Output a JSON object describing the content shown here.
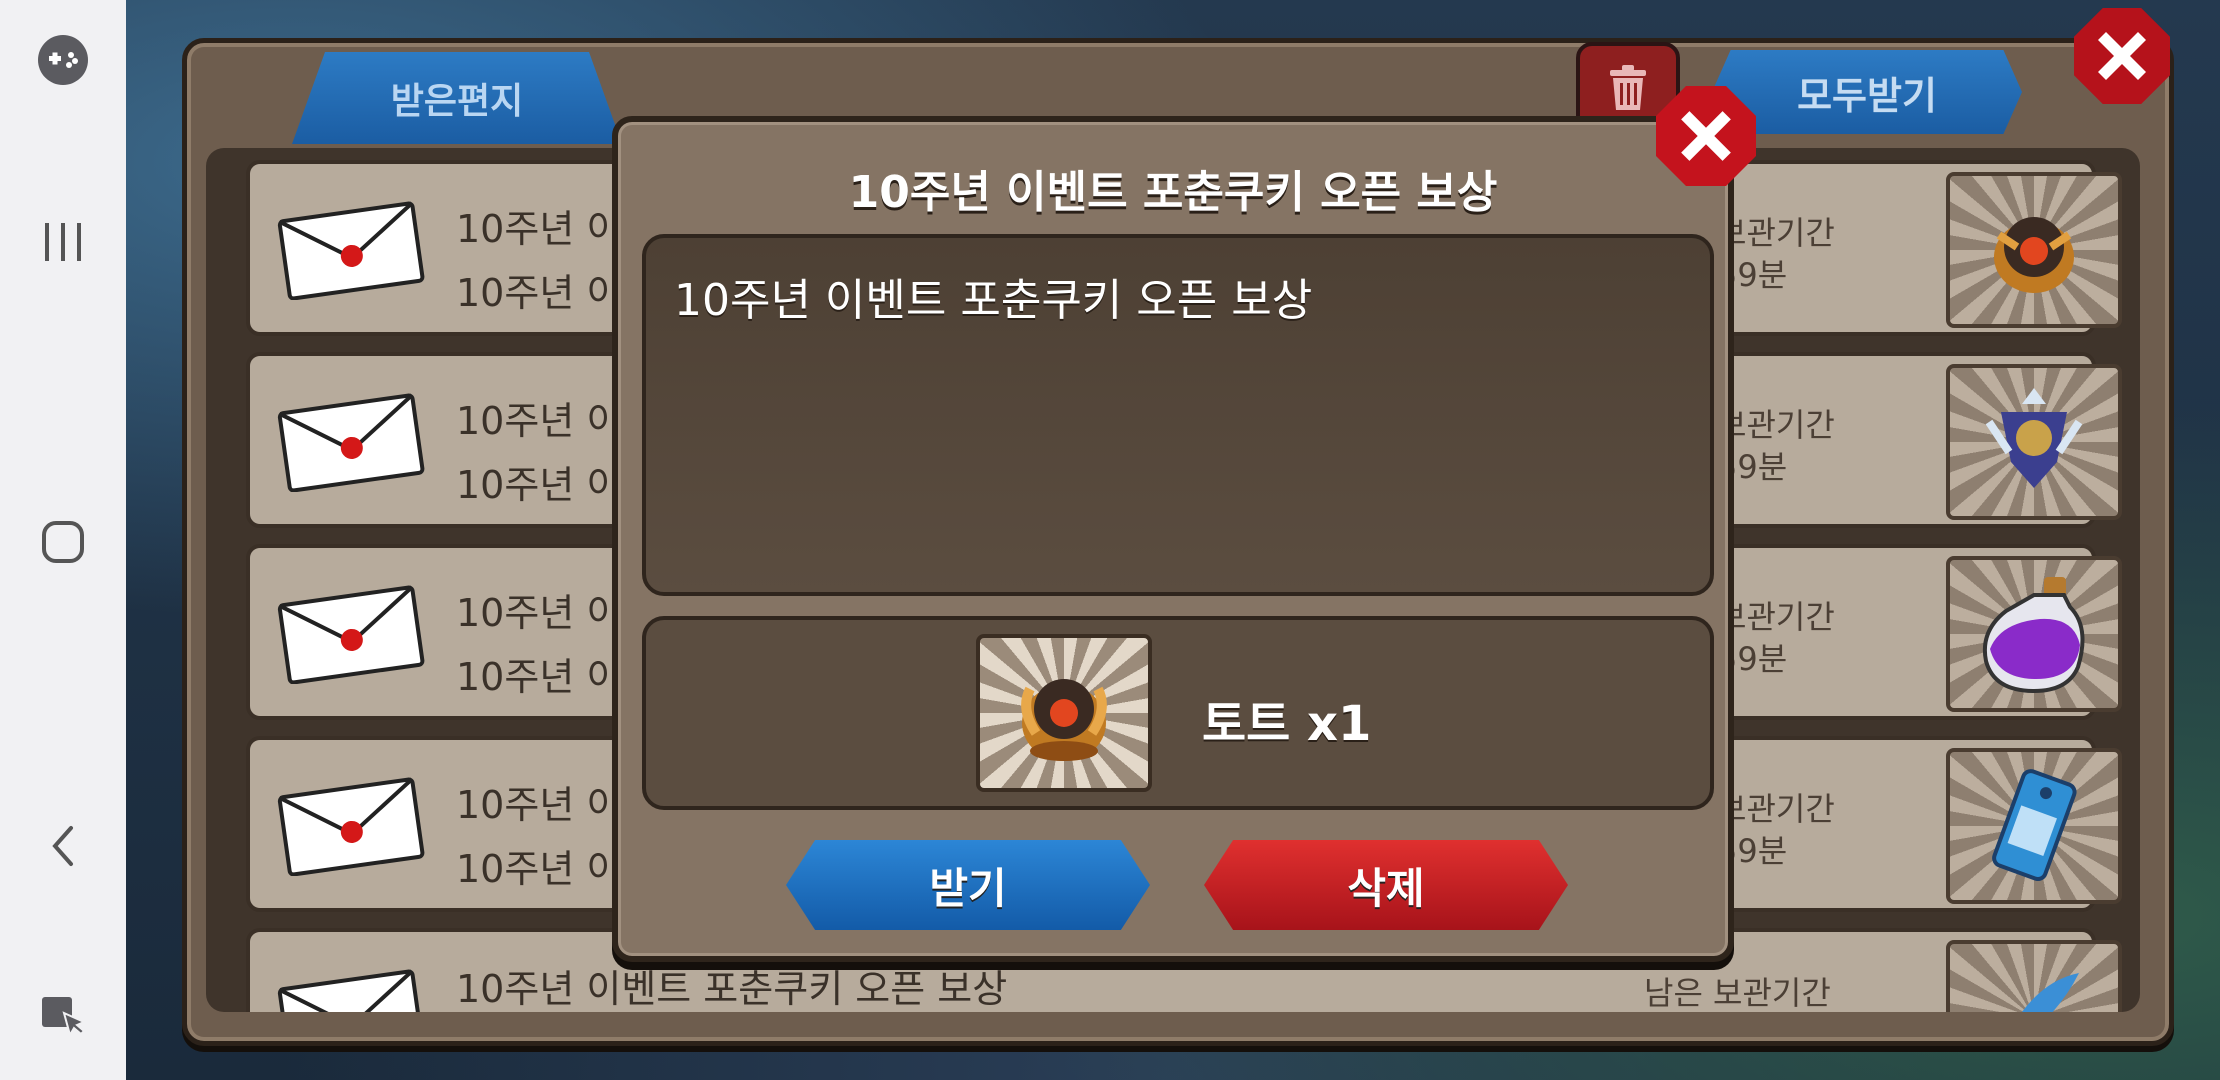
{
  "android_nav": {
    "icons": [
      "game-launcher-icon",
      "recent-apps-icon",
      "home-icon",
      "back-icon",
      "screen-capture-icon"
    ]
  },
  "mailbox": {
    "tab_label": "받은편지",
    "receive_all_label": "모두받기",
    "rows": [
      {
        "title": "10주년 이벤트 포춘쿠키 오픈 보상",
        "subtitle": "10주년 이벤트 포춘쿠키 오픈 보상",
        "remaining_label": "남은 보관기간",
        "remaining_time": "시간 59분",
        "item": "tot-emblem-icon"
      },
      {
        "title": "10주년 이벤트 포춘쿠키 오픈 보상",
        "subtitle": "10주년 이벤트 포춘쿠키 오픈 보상",
        "remaining_label": "남은 보관기간",
        "remaining_time": "시간 59분",
        "item": "crest-emblem-icon"
      },
      {
        "title": "10주년 이벤트 포춘쿠키 오픈 보상",
        "subtitle": "10주년 이벤트 포춘쿠키 오픈 보상",
        "remaining_label": "남은 보관기간",
        "remaining_time": "시간 59분",
        "item": "potion-bottle-icon"
      },
      {
        "title": "10주년 이벤트 포춘쿠키 오픈 보상",
        "subtitle": "10주년 이벤트 포춘쿠키 오픈 보상",
        "remaining_label": "남은 보관기간",
        "remaining_time": "시간 59분",
        "item": "ticket-icon"
      },
      {
        "title": "10주년 이벤트 포춘쿠키 오픈 보상",
        "subtitle": "",
        "remaining_label": "남은 보관기간",
        "remaining_time": "",
        "item": "feather-icon"
      }
    ]
  },
  "popup": {
    "title": "10주년 이벤트 포춘쿠키 오픈 보상",
    "message": "10주년 이벤트 포춘쿠키 오픈 보상",
    "reward_text": "토트 x1",
    "reward_icon": "tot-emblem-icon",
    "receive_label": "받기",
    "delete_label": "삭제"
  },
  "colors": {
    "panel": "#6e5d4e",
    "popup": "#857464",
    "blue_button": "#1b5da3",
    "red_button": "#b5121b"
  }
}
